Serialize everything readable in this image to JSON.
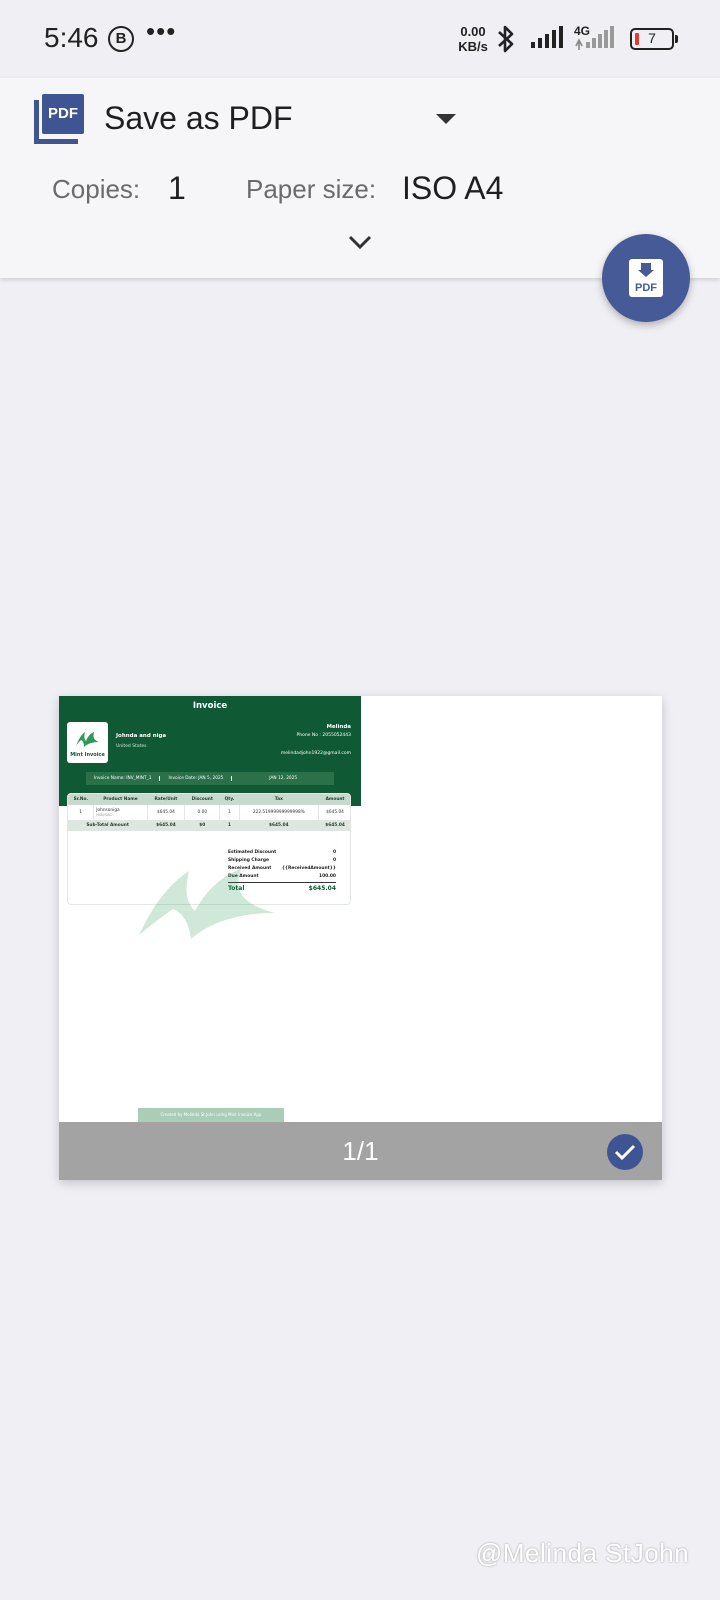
{
  "status_bar": {
    "time": "5:46",
    "b_badge": "B",
    "more": "•••",
    "speed_value": "0.00",
    "speed_unit": "KB/s",
    "network": "4G",
    "battery": "7",
    "battery_color": "#e53935"
  },
  "header": {
    "printer_icon": "pdf-printer-icon",
    "printer_icon_label": "PDF",
    "printer_name": "Save as PDF",
    "copies_label": "Copies:",
    "copies_value": "1",
    "paper_label": "Paper size:",
    "paper_value": "ISO A4"
  },
  "fab": {
    "icon": "download-pdf-icon",
    "label": "PDF",
    "color": "#455a96"
  },
  "preview": {
    "page_counter": "1/1",
    "invoice": {
      "title": "Invoice",
      "logo_text": "Mint Invoice",
      "from_name": "Johnda and niga",
      "from_country": "United States",
      "to_name": "Melinda",
      "to_phone": "Phone No : 2055052443",
      "to_email": "melindadjohn1922@gmail.com",
      "invoice_name": "Invoice Name: INV_MINT_1",
      "invoice_date": "Invoice Date: JAN 5, 2025",
      "due_date": "JAN 12, 2025",
      "columns": [
        "Sr.No.",
        "Product Name",
        "Rate/Unit",
        "Discount",
        "Qty.",
        "Tax",
        "Amount"
      ],
      "rows": [
        {
          "sr": "1",
          "product": "Johnsoniga",
          "product_sub": "HSN/SAC : -",
          "rate": "$645.04",
          "discount": "0.00",
          "qty": "1",
          "tax": "222.51999999999998%",
          "amount": "$645.04"
        }
      ],
      "subtotal": {
        "label": "Sub-Total Amount",
        "rate": "$645.04",
        "discount": "$0",
        "qty": "1",
        "tax": "$645.04",
        "amount": "$645.04"
      },
      "summary": [
        {
          "label": "Estimated Discount",
          "value": "0"
        },
        {
          "label": "Shipping Charge",
          "value": "0"
        },
        {
          "label": "Received Amount",
          "value": "{{ReceivedAmount}}"
        },
        {
          "label": "Due Amount",
          "value": "100.00"
        }
      ],
      "total_label": "Total",
      "total_value": "$645.04",
      "footer": "Created by Melinda St.John using Mint Invoice App",
      "brand_color": "#0f5a34"
    }
  },
  "watermark": "@Melinda StJohn"
}
